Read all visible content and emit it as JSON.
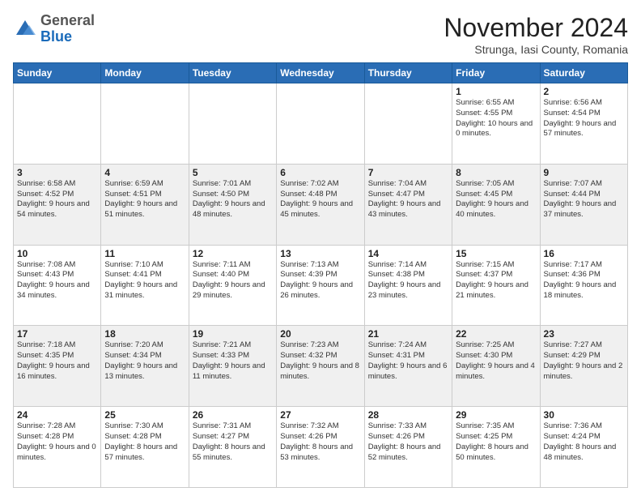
{
  "header": {
    "logo_general": "General",
    "logo_blue": "Blue",
    "month_title": "November 2024",
    "location": "Strunga, Iasi County, Romania"
  },
  "weekdays": [
    "Sunday",
    "Monday",
    "Tuesday",
    "Wednesday",
    "Thursday",
    "Friday",
    "Saturday"
  ],
  "weeks": [
    {
      "days": [
        {
          "num": "",
          "info": ""
        },
        {
          "num": "",
          "info": ""
        },
        {
          "num": "",
          "info": ""
        },
        {
          "num": "",
          "info": ""
        },
        {
          "num": "",
          "info": ""
        },
        {
          "num": "1",
          "info": "Sunrise: 6:55 AM\nSunset: 4:55 PM\nDaylight: 10 hours\nand 0 minutes."
        },
        {
          "num": "2",
          "info": "Sunrise: 6:56 AM\nSunset: 4:54 PM\nDaylight: 9 hours\nand 57 minutes."
        }
      ]
    },
    {
      "days": [
        {
          "num": "3",
          "info": "Sunrise: 6:58 AM\nSunset: 4:52 PM\nDaylight: 9 hours\nand 54 minutes."
        },
        {
          "num": "4",
          "info": "Sunrise: 6:59 AM\nSunset: 4:51 PM\nDaylight: 9 hours\nand 51 minutes."
        },
        {
          "num": "5",
          "info": "Sunrise: 7:01 AM\nSunset: 4:50 PM\nDaylight: 9 hours\nand 48 minutes."
        },
        {
          "num": "6",
          "info": "Sunrise: 7:02 AM\nSunset: 4:48 PM\nDaylight: 9 hours\nand 45 minutes."
        },
        {
          "num": "7",
          "info": "Sunrise: 7:04 AM\nSunset: 4:47 PM\nDaylight: 9 hours\nand 43 minutes."
        },
        {
          "num": "8",
          "info": "Sunrise: 7:05 AM\nSunset: 4:45 PM\nDaylight: 9 hours\nand 40 minutes."
        },
        {
          "num": "9",
          "info": "Sunrise: 7:07 AM\nSunset: 4:44 PM\nDaylight: 9 hours\nand 37 minutes."
        }
      ]
    },
    {
      "days": [
        {
          "num": "10",
          "info": "Sunrise: 7:08 AM\nSunset: 4:43 PM\nDaylight: 9 hours\nand 34 minutes."
        },
        {
          "num": "11",
          "info": "Sunrise: 7:10 AM\nSunset: 4:41 PM\nDaylight: 9 hours\nand 31 minutes."
        },
        {
          "num": "12",
          "info": "Sunrise: 7:11 AM\nSunset: 4:40 PM\nDaylight: 9 hours\nand 29 minutes."
        },
        {
          "num": "13",
          "info": "Sunrise: 7:13 AM\nSunset: 4:39 PM\nDaylight: 9 hours\nand 26 minutes."
        },
        {
          "num": "14",
          "info": "Sunrise: 7:14 AM\nSunset: 4:38 PM\nDaylight: 9 hours\nand 23 minutes."
        },
        {
          "num": "15",
          "info": "Sunrise: 7:15 AM\nSunset: 4:37 PM\nDaylight: 9 hours\nand 21 minutes."
        },
        {
          "num": "16",
          "info": "Sunrise: 7:17 AM\nSunset: 4:36 PM\nDaylight: 9 hours\nand 18 minutes."
        }
      ]
    },
    {
      "days": [
        {
          "num": "17",
          "info": "Sunrise: 7:18 AM\nSunset: 4:35 PM\nDaylight: 9 hours\nand 16 minutes."
        },
        {
          "num": "18",
          "info": "Sunrise: 7:20 AM\nSunset: 4:34 PM\nDaylight: 9 hours\nand 13 minutes."
        },
        {
          "num": "19",
          "info": "Sunrise: 7:21 AM\nSunset: 4:33 PM\nDaylight: 9 hours\nand 11 minutes."
        },
        {
          "num": "20",
          "info": "Sunrise: 7:23 AM\nSunset: 4:32 PM\nDaylight: 9 hours\nand 8 minutes."
        },
        {
          "num": "21",
          "info": "Sunrise: 7:24 AM\nSunset: 4:31 PM\nDaylight: 9 hours\nand 6 minutes."
        },
        {
          "num": "22",
          "info": "Sunrise: 7:25 AM\nSunset: 4:30 PM\nDaylight: 9 hours\nand 4 minutes."
        },
        {
          "num": "23",
          "info": "Sunrise: 7:27 AM\nSunset: 4:29 PM\nDaylight: 9 hours\nand 2 minutes."
        }
      ]
    },
    {
      "days": [
        {
          "num": "24",
          "info": "Sunrise: 7:28 AM\nSunset: 4:28 PM\nDaylight: 9 hours\nand 0 minutes."
        },
        {
          "num": "25",
          "info": "Sunrise: 7:30 AM\nSunset: 4:28 PM\nDaylight: 8 hours\nand 57 minutes."
        },
        {
          "num": "26",
          "info": "Sunrise: 7:31 AM\nSunset: 4:27 PM\nDaylight: 8 hours\nand 55 minutes."
        },
        {
          "num": "27",
          "info": "Sunrise: 7:32 AM\nSunset: 4:26 PM\nDaylight: 8 hours\nand 53 minutes."
        },
        {
          "num": "28",
          "info": "Sunrise: 7:33 AM\nSunset: 4:26 PM\nDaylight: 8 hours\nand 52 minutes."
        },
        {
          "num": "29",
          "info": "Sunrise: 7:35 AM\nSunset: 4:25 PM\nDaylight: 8 hours\nand 50 minutes."
        },
        {
          "num": "30",
          "info": "Sunrise: 7:36 AM\nSunset: 4:24 PM\nDaylight: 8 hours\nand 48 minutes."
        }
      ]
    }
  ]
}
